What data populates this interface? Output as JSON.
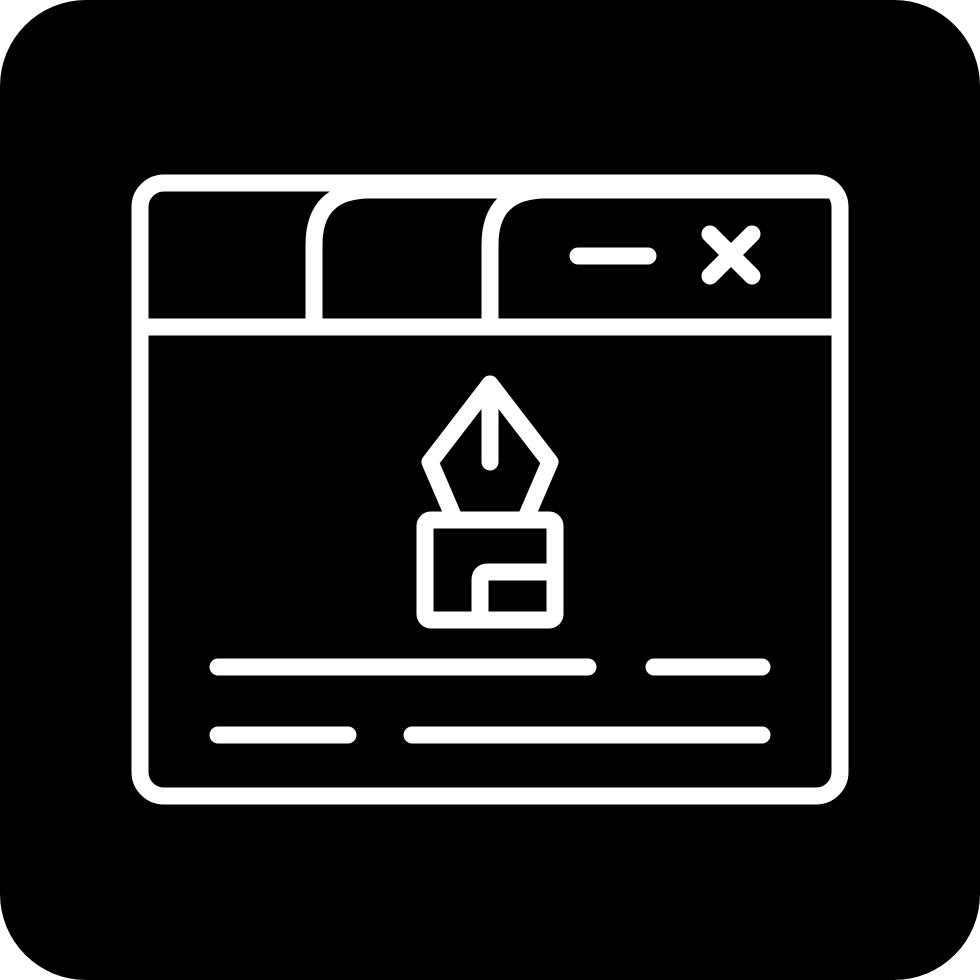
{
  "icon": {
    "name": "browser-window-pen-tool-icon",
    "background_color": "#000000",
    "line_color": "#ffffff"
  },
  "window": {
    "tabs": [
      "tab",
      "tab",
      "active-tab"
    ],
    "controls": [
      "minimize-icon",
      "close-icon"
    ],
    "content": {
      "center_icon": "pen-nib-icon",
      "text_lines": 4
    }
  }
}
